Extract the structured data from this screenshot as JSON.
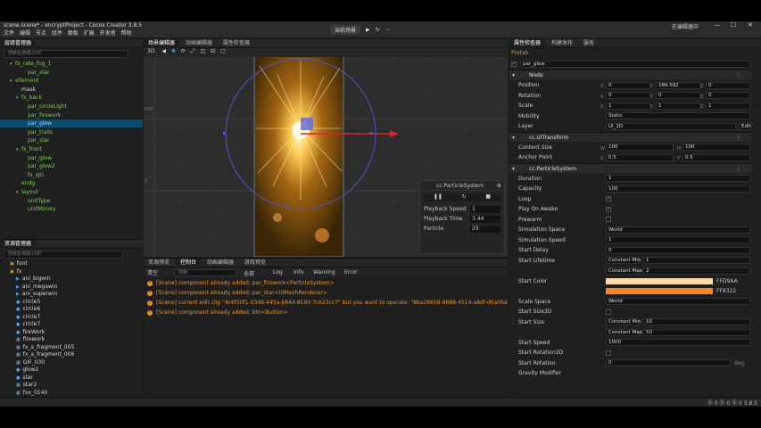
{
  "window": {
    "title": "scene.scene* - encryptProject - Cocos Creator 3.8.5",
    "right_button": "在编辑器中",
    "controls": [
      "—",
      "☐",
      "✕"
    ]
  },
  "menu": [
    "文件",
    "编辑",
    "节点",
    "组件",
    "面板",
    "扩展",
    "开发者",
    "帮助"
  ],
  "toolbar": {
    "platform": "当前场景",
    "play": "▶",
    "refresh": "↻",
    "more": "⋯"
  },
  "hierarchy": {
    "tab": "层级管理器",
    "search_placeholder": "搜索名称或UUID",
    "rows": [
      {
        "label": "fx_rate_fog_1",
        "indent": 1,
        "color": "green",
        "arrow": "▾"
      },
      {
        "label": "par_star",
        "indent": 3,
        "color": "green",
        "arrow": ""
      },
      {
        "label": "stlemont",
        "indent": 1,
        "color": "green",
        "arrow": "▾"
      },
      {
        "label": "mask",
        "indent": 2,
        "color": "white",
        "arrow": ""
      },
      {
        "label": "fx_back",
        "indent": 2,
        "color": "green",
        "arrow": "▾"
      },
      {
        "label": "par_circleLight",
        "indent": 3,
        "color": "green",
        "arrow": ""
      },
      {
        "label": "par_firework",
        "indent": 3,
        "color": "green",
        "arrow": ""
      },
      {
        "label": "par_glew",
        "indent": 3,
        "color": "white",
        "arrow": "",
        "selected": true
      },
      {
        "label": "par_trails",
        "indent": 3,
        "color": "green",
        "arrow": ""
      },
      {
        "label": "par_star",
        "indent": 3,
        "color": "green",
        "arrow": ""
      },
      {
        "label": "fx_front",
        "indent": 2,
        "color": "green",
        "arrow": "▾"
      },
      {
        "label": "par_glew",
        "indent": 3,
        "color": "green",
        "arrow": ""
      },
      {
        "label": "par_glew2",
        "indent": 3,
        "color": "green",
        "arrow": ""
      },
      {
        "label": "fx_sJG",
        "indent": 3,
        "color": "green",
        "arrow": ""
      },
      {
        "label": "endg",
        "indent": 2,
        "color": "green",
        "arrow": ""
      },
      {
        "label": "layout",
        "indent": 2,
        "color": "green",
        "arrow": "▾"
      },
      {
        "label": "unitType",
        "indent": 3,
        "color": "green",
        "arrow": ""
      },
      {
        "label": "unitMoney",
        "indent": 3,
        "color": "green",
        "arrow": ""
      }
    ]
  },
  "assets": {
    "tab": "资源管理器",
    "search_placeholder": "搜索名称或UUID",
    "rows": [
      {
        "label": "font",
        "indent": 1,
        "icon": "folder"
      },
      {
        "label": "fx",
        "indent": 1,
        "icon": "folder"
      },
      {
        "label": "ani_bigwin",
        "indent": 2,
        "icon": "anim"
      },
      {
        "label": "ani_megawin",
        "indent": 2,
        "icon": "anim"
      },
      {
        "label": "ani_superwin",
        "indent": 2,
        "icon": "anim"
      },
      {
        "label": "circle5",
        "indent": 2,
        "icon": "dot"
      },
      {
        "label": "circle6",
        "indent": 2,
        "icon": "dot"
      },
      {
        "label": "circle7",
        "indent": 2,
        "icon": "dot"
      },
      {
        "label": "circle7",
        "indent": 2,
        "icon": "dot"
      },
      {
        "label": "fireWork",
        "indent": 2,
        "icon": "dot"
      },
      {
        "label": "firework",
        "indent": 2,
        "icon": "img"
      },
      {
        "label": "fx_a_fragment_005",
        "indent": 2,
        "icon": "img"
      },
      {
        "label": "fx_a_fragment_006",
        "indent": 2,
        "icon": "img"
      },
      {
        "label": "GIF_030",
        "indent": 2,
        "icon": "img"
      },
      {
        "label": "glow2",
        "indent": 2,
        "icon": "dot"
      },
      {
        "label": "star",
        "indent": 2,
        "icon": "dot"
      },
      {
        "label": "star2",
        "indent": 2,
        "icon": "img"
      },
      {
        "label": "fxx_0140",
        "indent": 2,
        "icon": "img"
      }
    ]
  },
  "scene": {
    "tabs": [
      "场景编辑器",
      "动画编辑器",
      "属性检查器"
    ],
    "ruler_left": [
      "500",
      "0"
    ],
    "tools": [
      "3D",
      "◀",
      "✥",
      "⟳",
      "⤢",
      "◫",
      "⊟",
      "▢"
    ],
    "particle_panel": {
      "title": "cc.ParticleSystem",
      "rows": [
        {
          "label": "Playback Speed",
          "value": "1"
        },
        {
          "label": "Playback Time",
          "value": "3.44"
        },
        {
          "label": "Particle",
          "value": "29"
        }
      ]
    }
  },
  "console": {
    "tabs": [
      "资源预览",
      "控制台",
      "动画编辑器",
      "游戏预览"
    ],
    "toolbar": {
      "clear": "清空",
      "search_placeholder": "搜索",
      "all": "全部",
      "log": "Log",
      "info": "Info",
      "warning": "Warning",
      "error": "Error"
    },
    "messages": [
      "[Scene] component already added: par_firework<ParticleSystem>",
      "[Scene] component already added: par_star<UIMeshRenderer>",
      "[Scene] current edit clip \"4c6f50f1-53d6-445a-b844-8190 7c623cc7\" but you want to operate: \"8ba26658-8888-4514-a8df-d6a06d9d2580",
      "[Scene] component already added: btn<Button>"
    ]
  },
  "inspector": {
    "tabs": [
      "属性检查器",
      "构建发布",
      "服务"
    ],
    "prefab": "Prefab",
    "node_name": "par_glew",
    "node_section": "Node",
    "position": [
      "0",
      "186.582",
      "0"
    ],
    "rotation": [
      "0",
      "0",
      "0"
    ],
    "scale": [
      "1",
      "1",
      "1"
    ],
    "mobility": "Static",
    "layer": "UI_2D",
    "layer_btn": "Edit",
    "uitransform": "cc.UITransform",
    "content_size": [
      "100",
      "100"
    ],
    "anchor": [
      "0.5",
      "0.5"
    ],
    "particle_section": "cc.ParticleSystem",
    "props": [
      {
        "label": "Duration",
        "value": "1",
        "type": "field"
      },
      {
        "label": "Capacity",
        "value": "100",
        "type": "field"
      },
      {
        "label": "Loop",
        "value": "✓",
        "type": "check"
      },
      {
        "label": "Play On Awake",
        "value": "✓",
        "type": "check"
      },
      {
        "label": "Prewarm",
        "value": "",
        "type": "check"
      },
      {
        "label": "Simulation Space",
        "value": "World",
        "type": "select"
      },
      {
        "label": "Simulation Speed",
        "value": "1",
        "type": "field"
      },
      {
        "label": "Start Delay",
        "value": "0",
        "type": "field"
      }
    ],
    "start_lifetime": {
      "label": "Start Lifetime",
      "min_label": "Constant Min",
      "min": "1",
      "max_label": "Constant Max",
      "max": "2"
    },
    "start_color": {
      "label": "Start Color",
      "c1": "#ffd9aa",
      "c1_label": "FFD9AA",
      "c2": "#ff8322",
      "c2_label": "FF8322"
    },
    "scale_space": {
      "label": "Scale Space",
      "value": "World"
    },
    "start_size3d": "Start Size3D",
    "start_size": {
      "label": "Start Size",
      "min_label": "Constant Min",
      "min": "10",
      "max_label": "Constant Max",
      "max": "50"
    },
    "start_speed": {
      "label": "Start Speed",
      "value": "1000"
    },
    "start_rotation3d": "Start Rotation3D",
    "start_rotation": {
      "label": "Start Rotation",
      "value": "0",
      "unit": "deg"
    },
    "gravity": "Gravity Modifier"
  },
  "status": {
    "left": "",
    "right": "⓪ 0  ⓪ 0  ⓪ 0  3.8.5"
  }
}
